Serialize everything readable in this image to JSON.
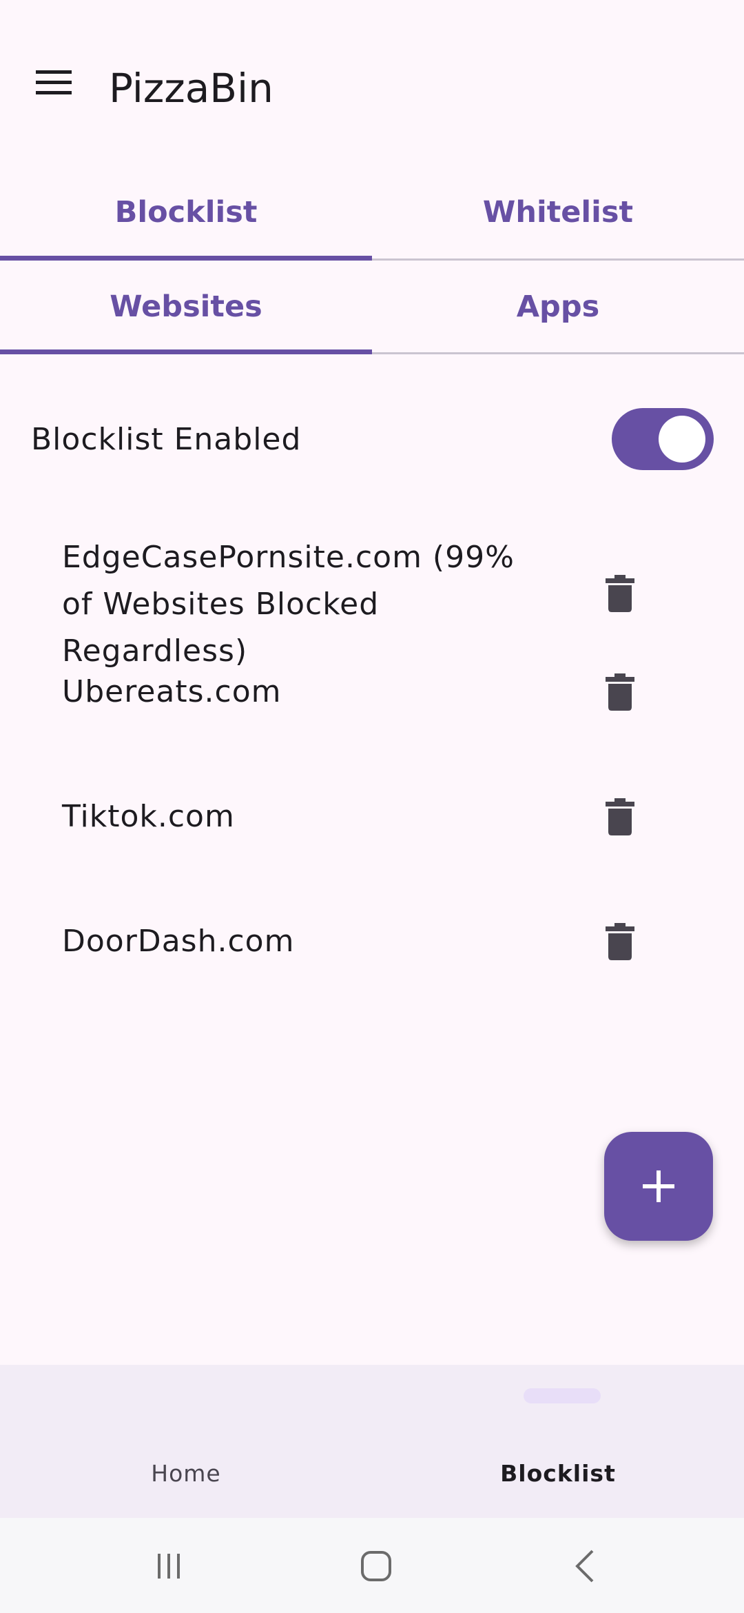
{
  "app_bar": {
    "title": "PizzaBin",
    "menu_icon": "hamburger-menu-icon"
  },
  "primary_tabs": [
    {
      "label": "Blocklist",
      "selected": true
    },
    {
      "label": "Whitelist",
      "selected": false
    }
  ],
  "secondary_tabs": [
    {
      "label": "Websites",
      "selected": true
    },
    {
      "label": "Apps",
      "selected": false
    }
  ],
  "blocklist_toggle": {
    "label": "Blocklist Enabled",
    "enabled": true
  },
  "websites": [
    {
      "name": "EdgeCasePornsite.com (99% of Websites Blocked Regardless)",
      "action_icon": "delete-icon"
    },
    {
      "name": "Ubereats.com",
      "action_icon": "delete-icon"
    },
    {
      "name": "Tiktok.com",
      "action_icon": "delete-icon"
    },
    {
      "name": "DoorDash.com",
      "action_icon": "delete-icon"
    }
  ],
  "fab": {
    "icon": "plus-icon"
  },
  "bottom_nav": [
    {
      "label": "Home",
      "selected": false
    },
    {
      "label": "Blocklist",
      "selected": true
    }
  ],
  "system_nav": {
    "recents_icon": "recents-icon",
    "home_icon": "home-icon",
    "back_icon": "back-icon"
  },
  "colors": {
    "primary": "#6750a4",
    "background": "#fef7fc",
    "nav_background": "#f2ecf6",
    "on_surface": "#1d1b20",
    "icon": "#49454f"
  }
}
